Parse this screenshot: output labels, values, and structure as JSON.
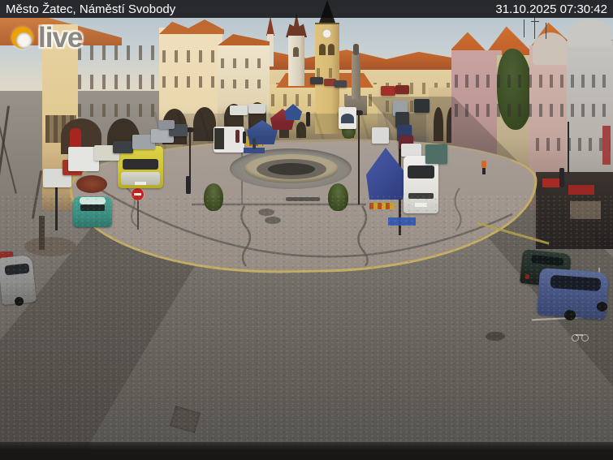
{
  "overlay": {
    "title": "Město Žatec, Náměstí Svobody",
    "timestamp": "31.10.2025 07:30:42"
  },
  "watermark": {
    "label": "live"
  },
  "scene": {
    "alt": "Morning webcam view of Náměstí Svobody square in Žatec: baroque town houses, town hall clock tower, plague column, market tents, vans and parked cars around an oval cobbled island with a circular fountain"
  },
  "colors": {
    "overlay_bar": "#0c0c0e",
    "overlay_text": "#ffffff",
    "watermark_orange": "#f0a800",
    "watermark_gray": "#7d7d7d"
  }
}
